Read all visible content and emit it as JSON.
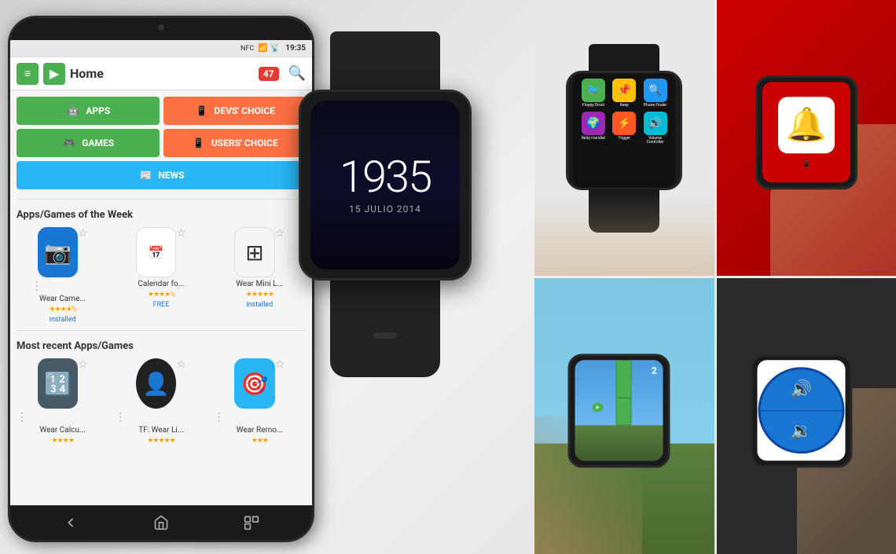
{
  "scene": {
    "bg_color": "#ffffff"
  },
  "phone": {
    "status_bar": {
      "signal": "NFC",
      "wifi": "WiFi",
      "network": "4G",
      "battery": "●",
      "time": "19:35"
    },
    "nav_title": "Home",
    "nav_badge": "47",
    "category_buttons": [
      {
        "label": "APPS",
        "type": "apps",
        "icon": "🤖"
      },
      {
        "label": "DEVS' CHOICE",
        "type": "devs",
        "icon": "📱"
      },
      {
        "label": "GAMES",
        "type": "games",
        "icon": "🎮"
      },
      {
        "label": "USERS' CHOICE",
        "type": "users",
        "icon": "📱"
      },
      {
        "label": "NEWS",
        "type": "news",
        "icon": "📰"
      }
    ],
    "section1_title": "Apps/Games of the Week",
    "apps_week": [
      {
        "name": "Wear Came...",
        "stars": "★★★★½",
        "status": "installed",
        "icon": "📷",
        "color": "#1976D2"
      },
      {
        "name": "Calendar fo...",
        "stars": "★★★★½",
        "status": "FREE",
        "icon": "📅",
        "color": "#fff"
      },
      {
        "name": "Wear Mini L...",
        "stars": "★★★★★",
        "status": "installed",
        "icon": "⊞",
        "color": "#f0f0f0"
      }
    ],
    "section2_title": "Most recent Apps/Games",
    "apps_recent": [
      {
        "name": "Wear Calcu...",
        "stars": "★★★★",
        "icon": "🔢",
        "color": "#455A64"
      },
      {
        "name": "TF: Wear Li...",
        "stars": "★★★★★",
        "icon": "👤",
        "color": "#212121"
      },
      {
        "name": "Wear Remo...",
        "stars": "★★★",
        "icon": "🎯",
        "color": "#29B6F6"
      }
    ]
  },
  "watch": {
    "time": "1935",
    "date": "15 JULIO 2014"
  },
  "panel_top_left": {
    "label": "Watch apps grid",
    "apps": [
      {
        "name": "Floppy Droid",
        "color": "#4CAF50"
      },
      {
        "name": "Keep",
        "color": "#FFC107"
      },
      {
        "name": "Phone Finder",
        "color": "#2196F3"
      },
      {
        "name": "Reloj mundial",
        "color": "#9C27B0"
      },
      {
        "name": "Trigger",
        "color": "#FF5722"
      },
      {
        "name": "Volume Controller",
        "color": "#00BCD4"
      }
    ]
  },
  "panel_top_right": {
    "label": "Notification watch",
    "bg_color": "#cc0000"
  },
  "panel_bottom_left": {
    "label": "Flappy Droid game",
    "score": "2"
  },
  "panel_bottom_right": {
    "label": "Volume controller",
    "color_top": "#1976D2",
    "color_bottom": "#1565C0"
  }
}
